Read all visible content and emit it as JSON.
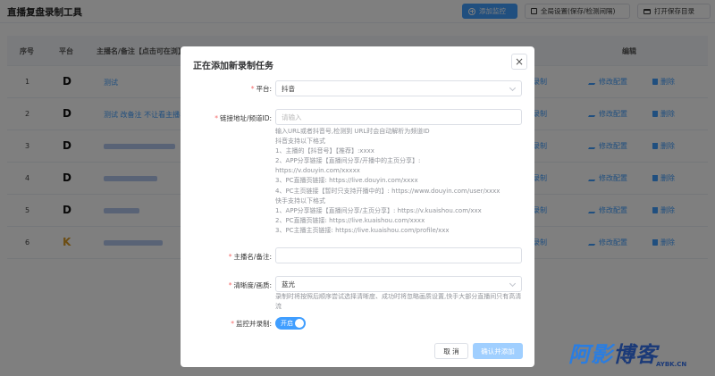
{
  "app": {
    "title": "直播复盘录制工具",
    "buttons": {
      "add_monitor": "添加监控",
      "global_settings": "全局设置(保存/检测间隔)",
      "open_save_dir": "打开保存目录"
    }
  },
  "table": {
    "headers": {
      "index": "序号",
      "platform": "平台",
      "streamer": "主播名/备注【点击可在浏】",
      "actions": "编辑"
    },
    "rows": [
      {
        "index": "1",
        "platform": "D",
        "name": "测试"
      },
      {
        "index": "2",
        "platform": "D",
        "name": "测试 改备注 不让看主播名"
      },
      {
        "index": "3",
        "platform": "D",
        "name": ""
      },
      {
        "index": "4",
        "platform": "D",
        "name": ""
      },
      {
        "index": "5",
        "platform": "D",
        "name": ""
      },
      {
        "index": "6",
        "platform": "K",
        "name": ""
      }
    ],
    "row_actions": {
      "edit": "修改配置",
      "delete": "删除",
      "partial": "录制"
    }
  },
  "dialog": {
    "title": "正在添加新录制任务",
    "close": "×",
    "platform": {
      "label": "平台:",
      "value": "抖音"
    },
    "url": {
      "label": "链接地址/频道ID:",
      "placeholder": "请输入"
    },
    "url_help": [
      "输入URL或者抖音号,检测到 URL时会自动解析为频道ID",
      "抖音支持以下格式",
      "1、主播的【抖音号】【推荐】:xxxx",
      "2、APP分享链接【直播间分享/开播中的主页分享】:",
      "https://v.douyin.com/xxxxx",
      "3、PC直播页链接: https://live.douyin.com/xxxx",
      "4、PC主页链接【暂时只支持开播中的】: https://www.douyin.com/user/xxxx",
      "快手支持以下格式",
      "1、APP分享链接【直播间分享/主页分享】: https://v.kuaishou.com/xxx",
      "2、PC直播页链接: https://live.kuaishou.com/xxxx",
      "3、PC主播主页链接: https://live.kuaishou.com/profile/xxx"
    ],
    "streamer": {
      "label": "主播名/备注:",
      "value": ""
    },
    "quality": {
      "label": "清晰度/画质:",
      "value": "蓝光",
      "help": "录制时将按照后顺序尝试选择清晰度、成功时将忽略画质设置,快手大部分直播间只有高清流"
    },
    "monitor": {
      "label": "监控并录制:",
      "switch_text": "开启",
      "on": true
    },
    "buttons": {
      "cancel": "取 消",
      "confirm": "确认并添加"
    }
  },
  "watermark": {
    "chars": [
      "阿",
      "影",
      "博",
      "客"
    ],
    "url": "AYBK.CN"
  },
  "colors": {
    "primary": "#409eff",
    "danger": "#f56c6c",
    "platform_k": "#d89a27"
  }
}
